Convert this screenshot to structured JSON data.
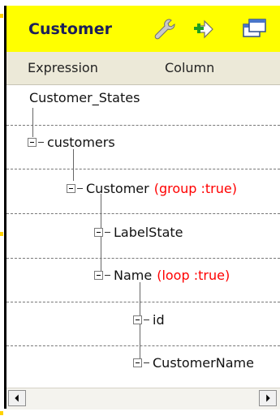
{
  "panel": {
    "title": "Customer",
    "toolbar_icons": [
      "wrench-icon",
      "add-arrow-icon",
      "window-icon"
    ]
  },
  "columns": {
    "expression": "Expression",
    "column": "Column"
  },
  "tree": {
    "root": "Customer_States",
    "nodes": [
      {
        "label": "customers",
        "attr": ""
      },
      {
        "label": "Customer",
        "attr": "(group :true)"
      },
      {
        "label": "LabelState",
        "attr": ""
      },
      {
        "label": "Name",
        "attr": "(loop :true)"
      },
      {
        "label": "id",
        "attr": ""
      },
      {
        "label": "CustomerName",
        "attr": ""
      }
    ]
  },
  "colors": {
    "titlebar": "#ffff00",
    "title_text": "#1b1f5a",
    "attribute_text": "#ff0000"
  }
}
